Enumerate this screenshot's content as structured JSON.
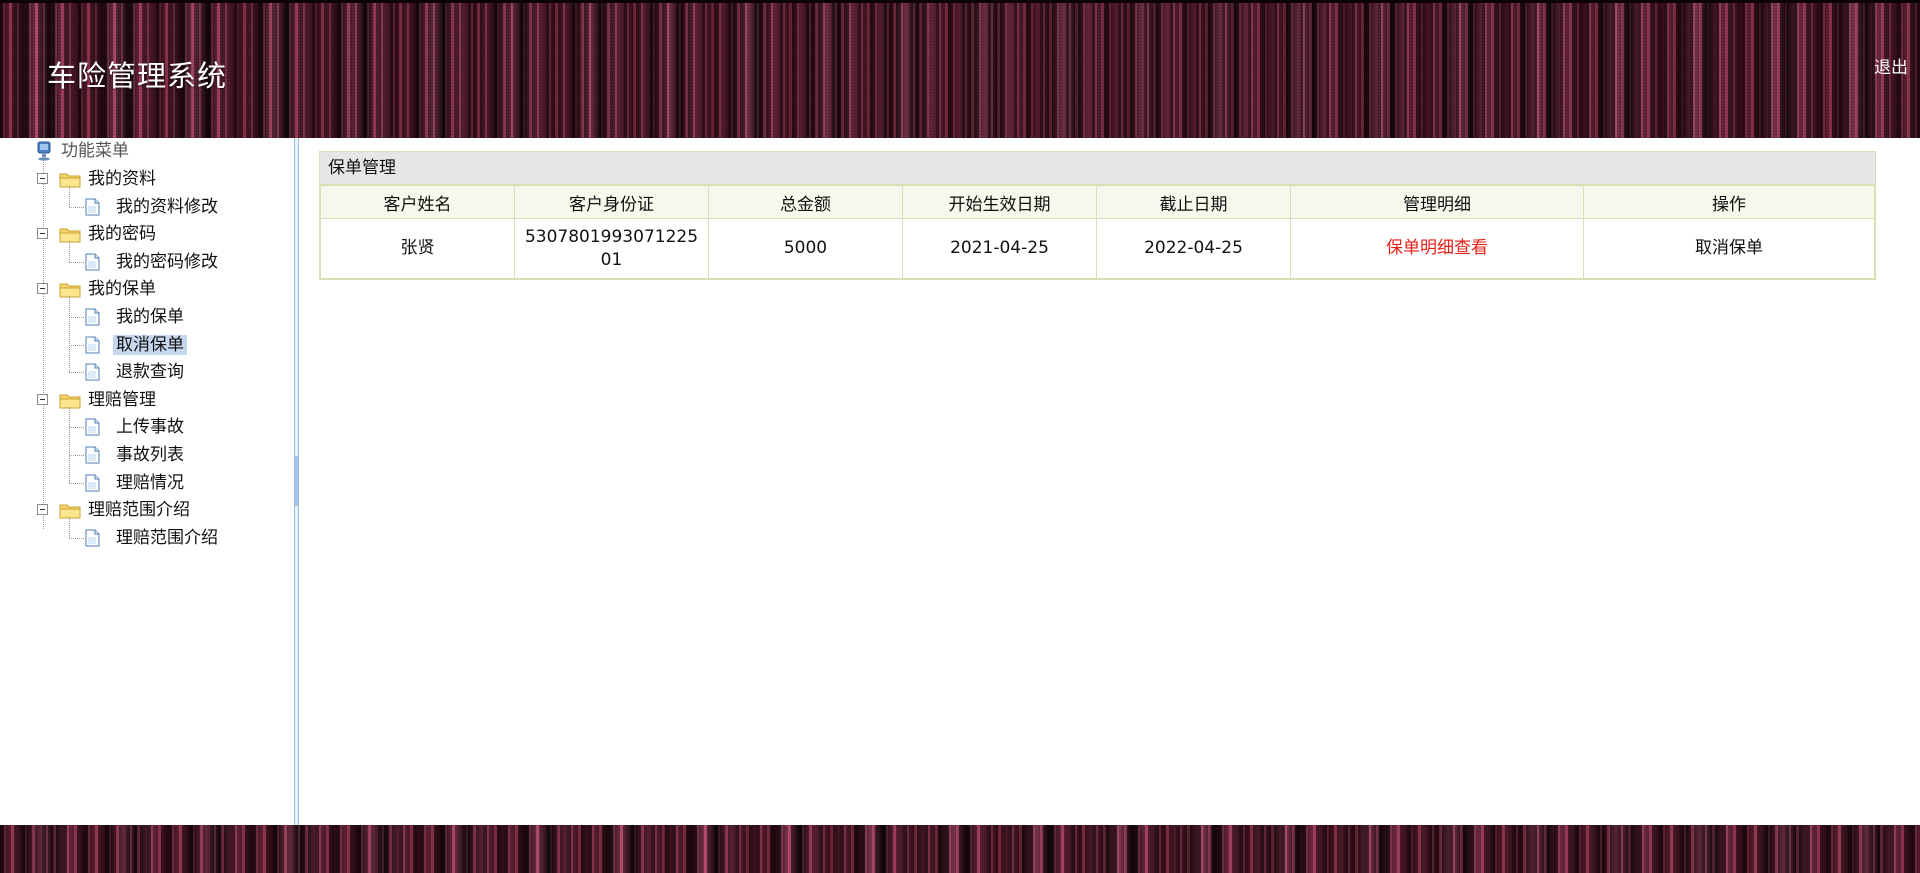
{
  "header": {
    "app_title": "车险管理系统",
    "logout_label": "退出"
  },
  "sidebar": {
    "root_label": "功能菜单",
    "groups": [
      {
        "label": "我的资料",
        "items": [
          {
            "label": "我的资料修改"
          }
        ]
      },
      {
        "label": "我的密码",
        "items": [
          {
            "label": "我的密码修改"
          }
        ]
      },
      {
        "label": "我的保单",
        "items": [
          {
            "label": "我的保单"
          },
          {
            "label": "取消保单",
            "selected": true
          },
          {
            "label": "退款查询"
          }
        ]
      },
      {
        "label": "理赔管理",
        "items": [
          {
            "label": "上传事故"
          },
          {
            "label": "事故列表"
          },
          {
            "label": "理赔情况"
          }
        ]
      },
      {
        "label": "理赔范围介绍",
        "items": [
          {
            "label": "理赔范围介绍"
          }
        ]
      }
    ]
  },
  "panel": {
    "title": "保单管理",
    "columns": [
      "客户姓名",
      "客户身份证",
      "总金额",
      "开始生效日期",
      "截止日期",
      "管理明细",
      "操作"
    ],
    "rows": [
      {
        "name": "张贤",
        "id_card": "530780199307122501",
        "amount": "5000",
        "start_date": "2021-04-25",
        "end_date": "2022-04-25",
        "detail_link": "保单明细查看",
        "action": "取消保单"
      }
    ]
  },
  "colors": {
    "detail_link": "#e62117",
    "selected_bg": "#c6d7ee"
  }
}
